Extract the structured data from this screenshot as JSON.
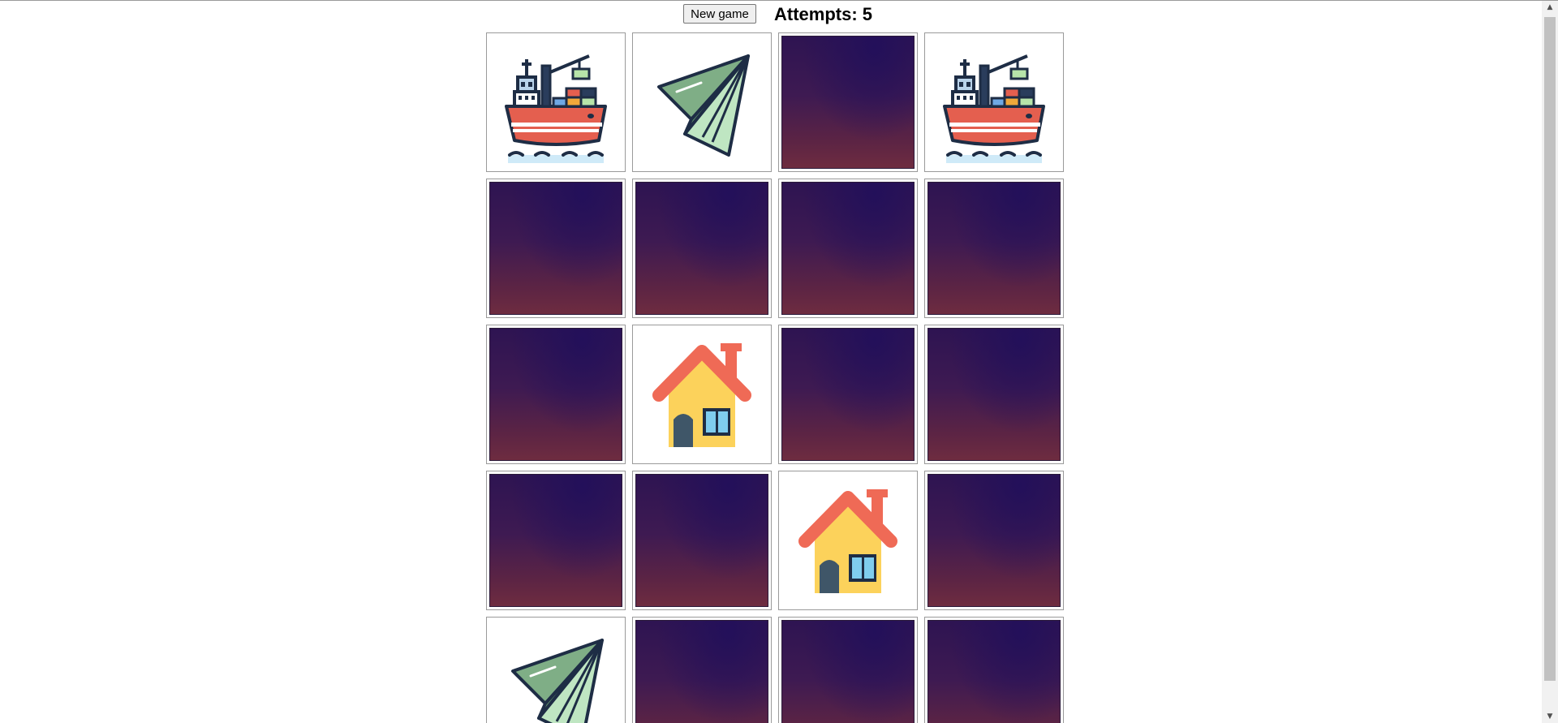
{
  "header": {
    "new_game_label": "New game",
    "attempts_text": "Attempts: 5"
  },
  "cards": [
    {
      "state": "revealed",
      "icon": "ship-icon"
    },
    {
      "state": "revealed",
      "icon": "paper-plane-icon"
    },
    {
      "state": "hidden",
      "icon": ""
    },
    {
      "state": "revealed",
      "icon": "ship-icon"
    },
    {
      "state": "hidden",
      "icon": ""
    },
    {
      "state": "hidden",
      "icon": ""
    },
    {
      "state": "hidden",
      "icon": ""
    },
    {
      "state": "hidden",
      "icon": ""
    },
    {
      "state": "hidden",
      "icon": ""
    },
    {
      "state": "revealed",
      "icon": "house-icon"
    },
    {
      "state": "hidden",
      "icon": ""
    },
    {
      "state": "hidden",
      "icon": ""
    },
    {
      "state": "hidden",
      "icon": ""
    },
    {
      "state": "hidden",
      "icon": ""
    },
    {
      "state": "revealed",
      "icon": "house-icon"
    },
    {
      "state": "hidden",
      "icon": ""
    },
    {
      "state": "revealed",
      "icon": "paper-plane-icon"
    },
    {
      "state": "hidden",
      "icon": ""
    },
    {
      "state": "hidden",
      "icon": ""
    },
    {
      "state": "hidden",
      "icon": ""
    }
  ],
  "scrollbar": {
    "up_arrow": "▲",
    "down_arrow": "▼"
  },
  "colors": {
    "card_back_top": "#2e1452",
    "card_back_bottom": "#6e2c40",
    "card_border": "#9a9a9a"
  }
}
